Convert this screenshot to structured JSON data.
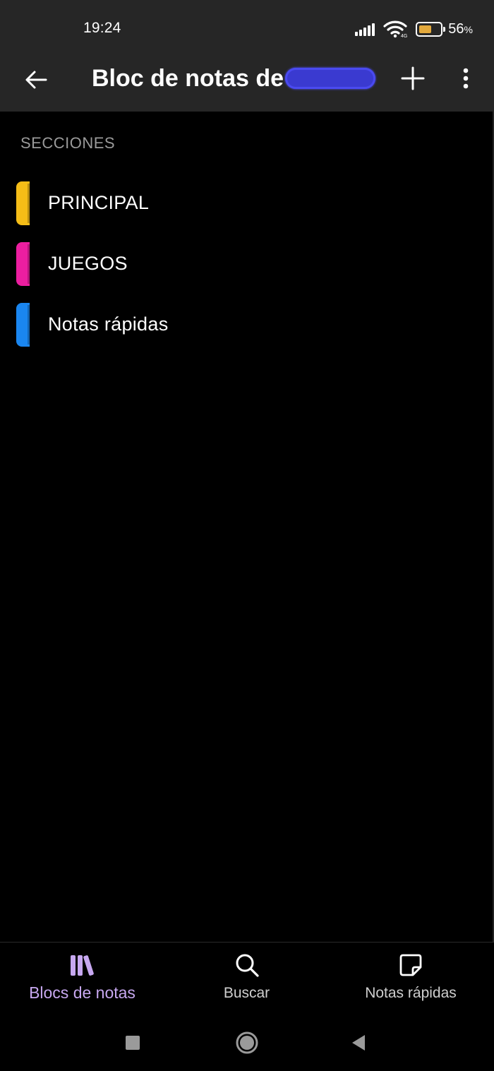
{
  "status_bar": {
    "time": "19:24",
    "battery_percent": "56",
    "battery_unit": "%",
    "battery_level": 0.56,
    "icons": [
      "signal-icon",
      "wifi-icon",
      "battery-icon"
    ]
  },
  "app_bar": {
    "title": "Bloc de notas de",
    "title_redacted": true,
    "actions": [
      "back-arrow-icon",
      "add-icon",
      "more-vert-icon"
    ]
  },
  "sections": {
    "header": "SECCIONES",
    "items": [
      {
        "label": "PRINCIPAL",
        "color": "#f5bd17"
      },
      {
        "label": "JUEGOS",
        "color": "#ec1ea0"
      },
      {
        "label": "Notas rápidas",
        "color": "#1a86f0"
      }
    ]
  },
  "bottom_nav": {
    "items": [
      {
        "label": "Blocs de notas",
        "icon": "notebooks-icon",
        "active": true
      },
      {
        "label": "Buscar",
        "icon": "search-icon",
        "active": false
      },
      {
        "label": "Notas rápidas",
        "icon": "sticky-note-icon",
        "active": false
      }
    ],
    "active_color": "#c7a8f0"
  },
  "system_nav": [
    "recents-square-icon",
    "home-circle-icon",
    "back-triangle-icon"
  ]
}
